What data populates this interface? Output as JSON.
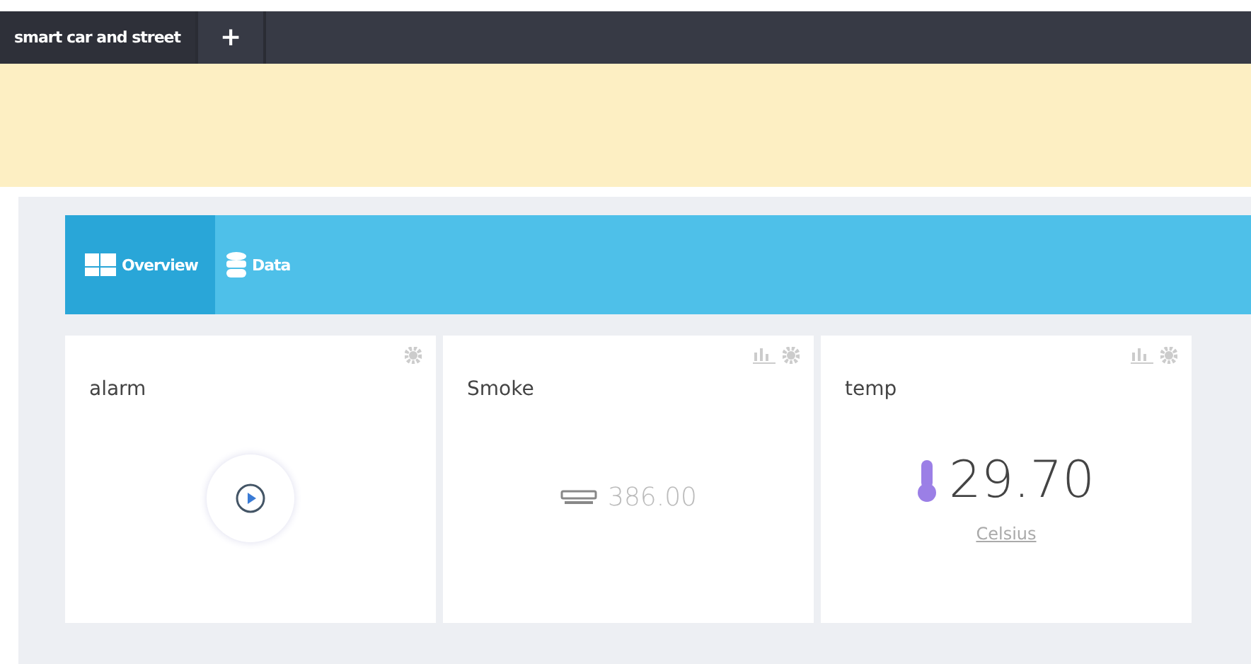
{
  "tabs": [
    {
      "label": "smart car and street",
      "selected": true
    },
    {
      "label": "+",
      "selected": false
    }
  ],
  "view_tabs": [
    {
      "label": "Overview",
      "selected": true
    },
    {
      "label": "Data",
      "selected": false
    }
  ],
  "widgets": [
    {
      "kind": "button",
      "title": "alarm",
      "chart": false
    },
    {
      "kind": "smoke",
      "title": "Smoke",
      "chart": true,
      "value": "386.00"
    },
    {
      "kind": "temperature",
      "title": "temp",
      "chart": true,
      "value": "29.70",
      "unit": "Celsius"
    }
  ]
}
